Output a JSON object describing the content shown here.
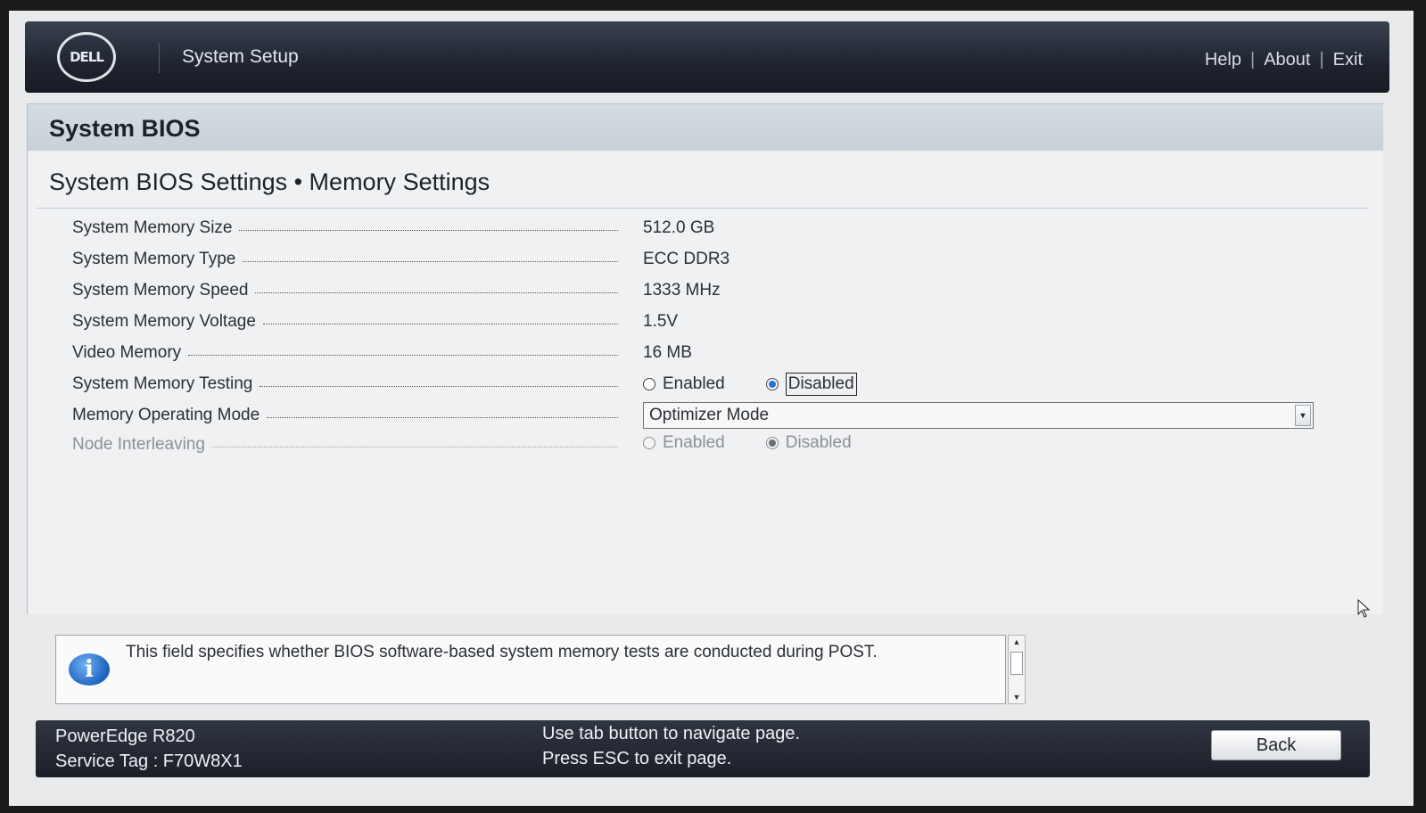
{
  "header": {
    "logo_text": "DELL",
    "title": "System Setup",
    "links": [
      "Help",
      "About",
      "Exit"
    ],
    "separator": "|"
  },
  "panel": {
    "title": "System BIOS",
    "section_title": "System BIOS Settings • Memory Settings"
  },
  "settings": {
    "memory_size": {
      "label": "System Memory Size",
      "value": "512.0 GB"
    },
    "memory_type": {
      "label": "System Memory Type",
      "value": "ECC DDR3"
    },
    "memory_speed": {
      "label": "System Memory Speed",
      "value": "1333 MHz"
    },
    "memory_voltage": {
      "label": "System Memory Voltage",
      "value": "1.5V"
    },
    "video_memory": {
      "label": "Video Memory",
      "value": "16 MB"
    },
    "memory_testing": {
      "label": "System Memory Testing",
      "options": [
        "Enabled",
        "Disabled"
      ],
      "selected": "Disabled"
    },
    "operating_mode": {
      "label": "Memory Operating Mode",
      "selected": "Optimizer Mode"
    },
    "node_interleaving": {
      "label": "Node Interleaving",
      "options": [
        "Enabled",
        "Disabled"
      ],
      "selected": "Disabled",
      "state": "disabled"
    }
  },
  "info": {
    "icon": "info-icon",
    "text": "This field specifies whether BIOS software-based system memory tests are conducted during POST."
  },
  "footer": {
    "model": "PowerEdge R820",
    "service_tag": "Service Tag : F70W8X1",
    "hint_tab": "Use tab button to navigate page.",
    "hint_esc": "Press ESC to exit page.",
    "back_label": "Back"
  },
  "colors": {
    "header_bg": "#1f2430",
    "panel_bg": "#f0f1f2",
    "title_bar": "#c7d0d8",
    "radio_selected": "#2c6fd0",
    "info_icon": "#1f63bd"
  }
}
